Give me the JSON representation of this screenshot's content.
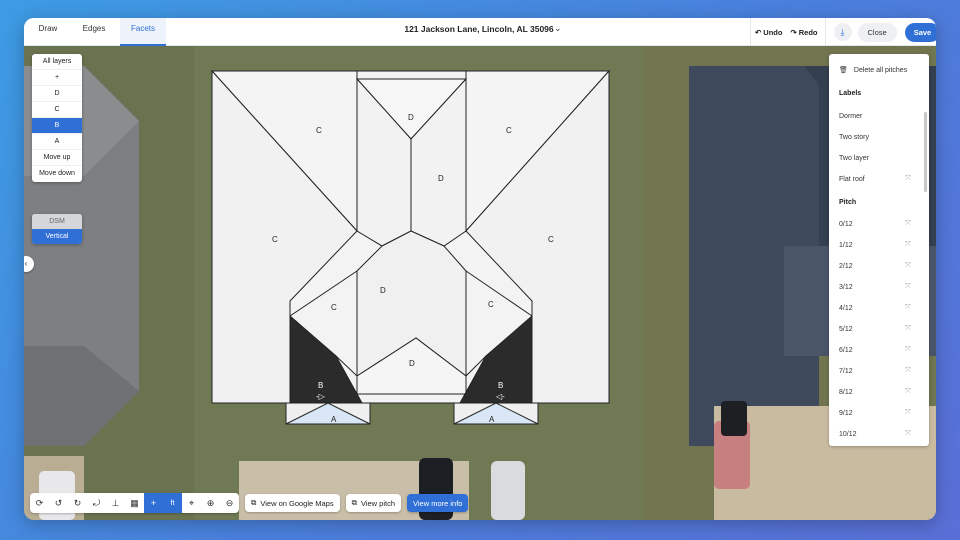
{
  "tabs": [
    {
      "label": "Draw"
    },
    {
      "label": "Edges"
    },
    {
      "label": "Facets"
    }
  ],
  "address": "121 Jackson Lane, Lincoln, AL 35096",
  "toolbar": {
    "undo": "Undo",
    "redo": "Redo",
    "close": "Close",
    "save": "Save"
  },
  "layers": {
    "all": "All layers",
    "add": "+",
    "items": [
      "D",
      "C",
      "B",
      "A"
    ],
    "selected": "B",
    "move_up": "Move up",
    "move_down": "Move down"
  },
  "view_modes": {
    "dsm": "DSM",
    "vertical": "Vertical",
    "active": "Vertical"
  },
  "right_panel": {
    "delete_all": "Delete all pitches",
    "labels_header": "Labels",
    "labels": [
      "Dormer",
      "Two story",
      "Two layer",
      "Flat roof"
    ],
    "pitch_header": "Pitch",
    "pitches": [
      "0/12",
      "1/12",
      "2/12",
      "3/12",
      "4/12",
      "5/12",
      "6/12",
      "7/12",
      "8/12",
      "9/12",
      "10/12"
    ]
  },
  "facets": {
    "C": "C",
    "D": "D",
    "B": "B",
    "A": "A"
  },
  "bottom": {
    "unit": "ft",
    "google_maps": "View on Google Maps",
    "view_pitch": "View pitch",
    "more_info": "View more info"
  },
  "colors": {
    "accent": "#2f6fd6",
    "facet_fill": "#f3f3f3",
    "facet_selected": "#2b2b2b"
  }
}
